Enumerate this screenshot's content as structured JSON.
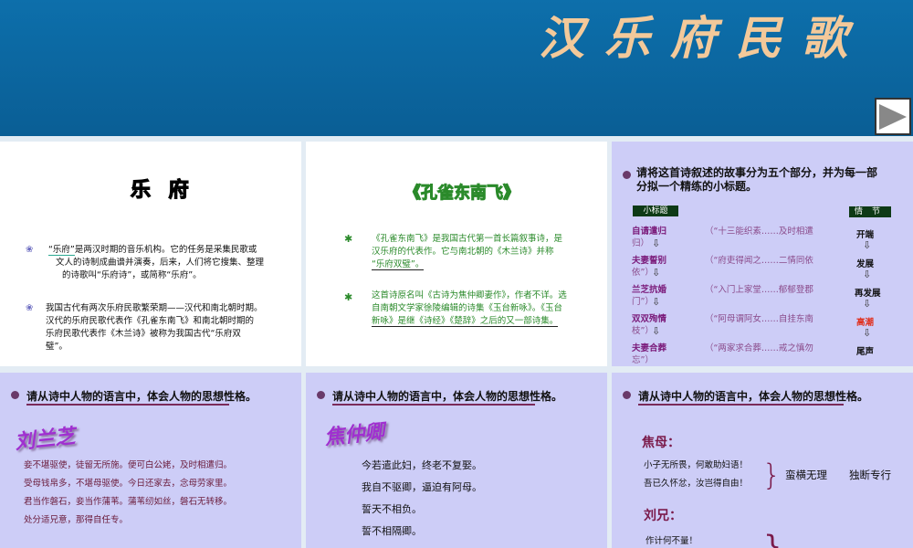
{
  "header": {
    "title": "汉乐府民歌",
    "next_icon": "play-triangle-icon"
  },
  "slide1": {
    "title": "乐 府",
    "p1_a": "“乐府”",
    "p1_b": "是两汉时期的音乐机构。它的任务是采集民歌或",
    "p1_c": "文人的诗制成曲谱并演奏，后来，人们将它搜集、整理",
    "p1_d": "的诗歌叫“乐府诗”，或简称“乐府”。",
    "p2_a": "我国古代有两次乐府民歌繁荣期——汉代和南北朝时期。",
    "p2_b": "汉代的乐府民歌代表作《孔雀东南飞》和南北朝时期的",
    "p2_c": "乐府民歌代表作《木兰诗》被称为我国古代“乐府双",
    "p2_d": "璧”。"
  },
  "slide2": {
    "title": "《孔雀东南飞》",
    "p1_a": "《孔雀东南飞》是我国古代第一首长篇叙事诗，是",
    "p1_b": "汉乐府的代表作。它与南北朝的《木兰诗》并称",
    "p1_c": "“乐府双璧”。",
    "p2_a": "这首诗原名叫《古诗为焦仲卿妻作》，作者不详。选",
    "p2_b": "自南朝文学家徐陵编辑的诗集《玉台新咏》。《玉台",
    "p2_c": "新咏》是继《诗经》《楚辞》之后的又一部诗集。"
  },
  "slide3": {
    "question_a": "请将这首诗叙述的故事分为五个部分，并为每一部",
    "question_b": "分拟一个精练的小标题。",
    "subtitle_label": "小标题",
    "plot_label": "情节",
    "rows": [
      {
        "title": "自请遣归",
        "quote": "（“十三能织素……及时相遣",
        "cont": "归）",
        "plot": "开端"
      },
      {
        "title": "夫妻誓别",
        "quote": "（“府吏得闻之……二情同依",
        "cont": "依”）",
        "plot": "发展"
      },
      {
        "title": "兰芝抗婚",
        "quote": "（“入门上家堂……郁郁登郡",
        "cont": "门”）",
        "plot": "再发展"
      },
      {
        "title": "双双殉情",
        "quote": "（“阿母谓阿女……自挂东南",
        "cont": "枝”）",
        "plot": "高潮"
      },
      {
        "title": "夫妻合葬",
        "quote": "（“两家求合葬……戒之慎勿",
        "cont": "忘”）",
        "plot": "尾声"
      }
    ]
  },
  "slide4": {
    "question": "请从诗中人物的语言中，体会人物的思想性格。",
    "name": "刘兰芝",
    "lines": [
      "妾不堪驱使，徒留无所施。便可白公姥，及时相遣归。",
      "受母钱帛多，不堪母驱使。今日还家去，念母劳家里。",
      "君当作磐石，妾当作蒲苇。蒲苇纫如丝，磐石无转移。",
      "处分适兄意，那得自任专。"
    ]
  },
  "slide5": {
    "question": "请从诗中人物的语言中，体会人物的思想性格。",
    "name": "焦仲卿",
    "lines": [
      "今若遣此妇，终老不复娶。",
      "我自不驱卿，逼迫有阿母。",
      "誓天不相负。",
      "誓不相隔卿。"
    ]
  },
  "slide6": {
    "question": "请从诗中人物的语言中，体会人物的思想性格。",
    "name1": "焦母：",
    "lines1": [
      "小子无所畏，何敢助妇语！",
      "吾已久怀忿，汝岂得自由！"
    ],
    "trait1": "蛮横无理",
    "trait2": "独断专行",
    "name2": "刘兄：",
    "lines2": [
      "作计何不量！"
    ]
  },
  "colors": {
    "header": "#0d6fab",
    "title": "#f3c99a",
    "lavender": "#cdcdf7",
    "green": "#2a8a2a",
    "purple": "#6a1a6a",
    "climax": "#e0301e"
  }
}
